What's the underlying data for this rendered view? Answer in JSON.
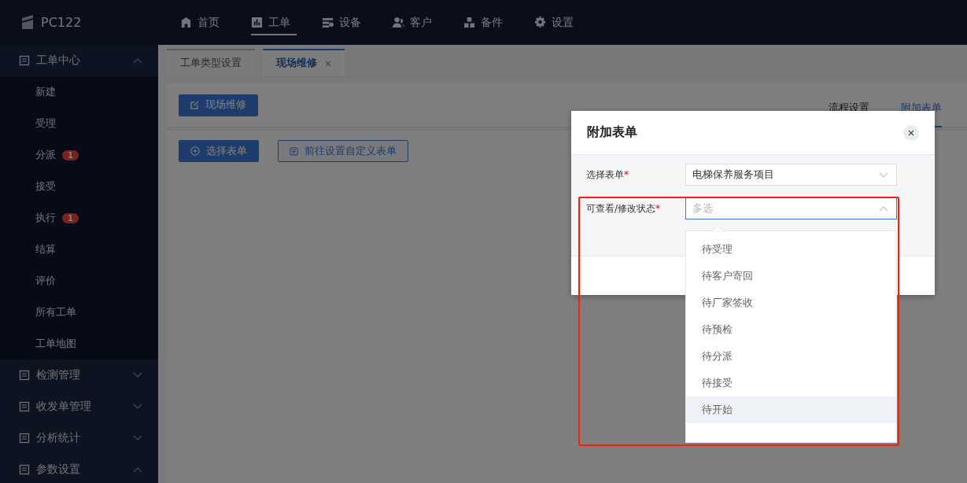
{
  "topbar": {
    "logo": "PC122",
    "nav": [
      {
        "label": "首页",
        "selected": false
      },
      {
        "label": "工单",
        "selected": true
      },
      {
        "label": "设备",
        "selected": false
      },
      {
        "label": "客户",
        "selected": false
      },
      {
        "label": "备件",
        "selected": false
      },
      {
        "label": "设置",
        "selected": false
      }
    ]
  },
  "sidebar": {
    "groups": [
      {
        "label": "工单中心",
        "expanded": true,
        "children": [
          {
            "label": "新建"
          },
          {
            "label": "受理"
          },
          {
            "label": "分派",
            "badge": "1"
          },
          {
            "label": "接受"
          },
          {
            "label": "执行",
            "badge": "1"
          },
          {
            "label": "结算"
          },
          {
            "label": "评价"
          },
          {
            "label": "所有工单"
          },
          {
            "label": "工单地图"
          }
        ]
      },
      {
        "label": "检测管理",
        "expanded": false
      },
      {
        "label": "收发单管理",
        "expanded": false
      },
      {
        "label": "分析统计",
        "expanded": false
      },
      {
        "label": "参数设置",
        "expanded": true
      }
    ]
  },
  "tabs": [
    {
      "label": "工单类型设置",
      "selected": false,
      "closable": false
    },
    {
      "label": "现场维修",
      "selected": true,
      "closable": true
    }
  ],
  "page": {
    "title_button": "现场维修",
    "section_tabs": [
      {
        "label": "流程设置",
        "selected": false
      },
      {
        "label": "附加表单",
        "selected": true
      }
    ],
    "buttons": [
      {
        "label": "选择表单",
        "kind": "primary"
      },
      {
        "label": "前往设置自定义表单",
        "kind": "outline"
      }
    ]
  },
  "dialog": {
    "title": "附加表单",
    "fields": [
      {
        "label": "选择表单",
        "required_mark": "*",
        "value": "电梯保养服务项目",
        "open": false
      },
      {
        "label": "可查看/修改状态",
        "required_mark": "*",
        "placeholder": "多选",
        "open": true
      }
    ],
    "options": [
      {
        "label": "待受理",
        "hovered": false
      },
      {
        "label": "待客户寄回",
        "hovered": false
      },
      {
        "label": "待厂家签收",
        "hovered": false
      },
      {
        "label": "待预检",
        "hovered": false
      },
      {
        "label": "待分派",
        "hovered": false
      },
      {
        "label": "待接受",
        "hovered": false
      },
      {
        "label": "待开始",
        "hovered": true
      }
    ]
  }
}
